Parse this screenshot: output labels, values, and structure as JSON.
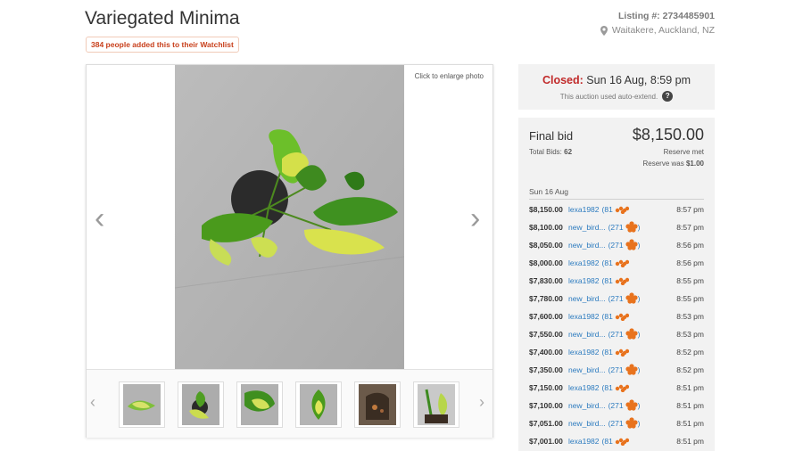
{
  "listing": {
    "title": "Variegated Minima",
    "watchlist_text": "384 people added this to their Watchlist",
    "listing_number": "Listing #: 2734485901",
    "location": "Waitakere, Auckland, NZ"
  },
  "gallery": {
    "enlarge_text": "Click to enlarge photo",
    "thumbnail_count": 6
  },
  "auction": {
    "closed_label": "Closed:",
    "closed_time": "Sun 16 Aug, 8:59 pm",
    "auto_extend_text": "This auction used auto-extend.",
    "final_bid_label": "Final bid",
    "final_bid_amount": "$8,150.00",
    "total_bids_label": "Total Bids:",
    "total_bids": "62",
    "reserve_met": "Reserve met",
    "reserve_was_label": "Reserve was",
    "reserve_was_amount": "$1.00",
    "date_heading": "Sun 16 Aug"
  },
  "bids": [
    {
      "amount": "$8,150.00",
      "bidder": "lexa1982",
      "feedback": "(81",
      "time": "8:57 pm",
      "badge": "small"
    },
    {
      "amount": "$8,100.00",
      "bidder": "new_bird...",
      "feedback": "(271",
      "time": "8:57 pm",
      "badge": "large"
    },
    {
      "amount": "$8,050.00",
      "bidder": "new_bird...",
      "feedback": "(271",
      "time": "8:56 pm",
      "badge": "large"
    },
    {
      "amount": "$8,000.00",
      "bidder": "lexa1982",
      "feedback": "(81",
      "time": "8:56 pm",
      "badge": "small"
    },
    {
      "amount": "$7,830.00",
      "bidder": "lexa1982",
      "feedback": "(81",
      "time": "8:55 pm",
      "badge": "small"
    },
    {
      "amount": "$7,780.00",
      "bidder": "new_bird...",
      "feedback": "(271",
      "time": "8:55 pm",
      "badge": "large"
    },
    {
      "amount": "$7,600.00",
      "bidder": "lexa1982",
      "feedback": "(81",
      "time": "8:53 pm",
      "badge": "small"
    },
    {
      "amount": "$7,550.00",
      "bidder": "new_bird...",
      "feedback": "(271",
      "time": "8:53 pm",
      "badge": "large"
    },
    {
      "amount": "$7,400.00",
      "bidder": "lexa1982",
      "feedback": "(81",
      "time": "8:52 pm",
      "badge": "small"
    },
    {
      "amount": "$7,350.00",
      "bidder": "new_bird...",
      "feedback": "(271",
      "time": "8:52 pm",
      "badge": "large"
    },
    {
      "amount": "$7,150.00",
      "bidder": "lexa1982",
      "feedback": "(81",
      "time": "8:51 pm",
      "badge": "small"
    },
    {
      "amount": "$7,100.00",
      "bidder": "new_bird...",
      "feedback": "(271",
      "time": "8:51 pm",
      "badge": "large"
    },
    {
      "amount": "$7,051.00",
      "bidder": "new_bird...",
      "feedback": "(271",
      "time": "8:51 pm",
      "badge": "large"
    },
    {
      "amount": "$7,001.00",
      "bidder": "lexa1982",
      "feedback": "(81",
      "time": "8:51 pm",
      "badge": "small"
    }
  ],
  "colors": {
    "closed_red": "#c12a2a",
    "watchlist_orange": "#c8401c",
    "link_blue": "#2c7bbf",
    "feedback_orange": "#e8731e",
    "panel_gray": "#f2f2f2"
  },
  "icons": [
    "location-pin-icon",
    "help-icon",
    "chevron-left-icon",
    "chevron-right-icon",
    "feedback-badge-icon"
  ]
}
